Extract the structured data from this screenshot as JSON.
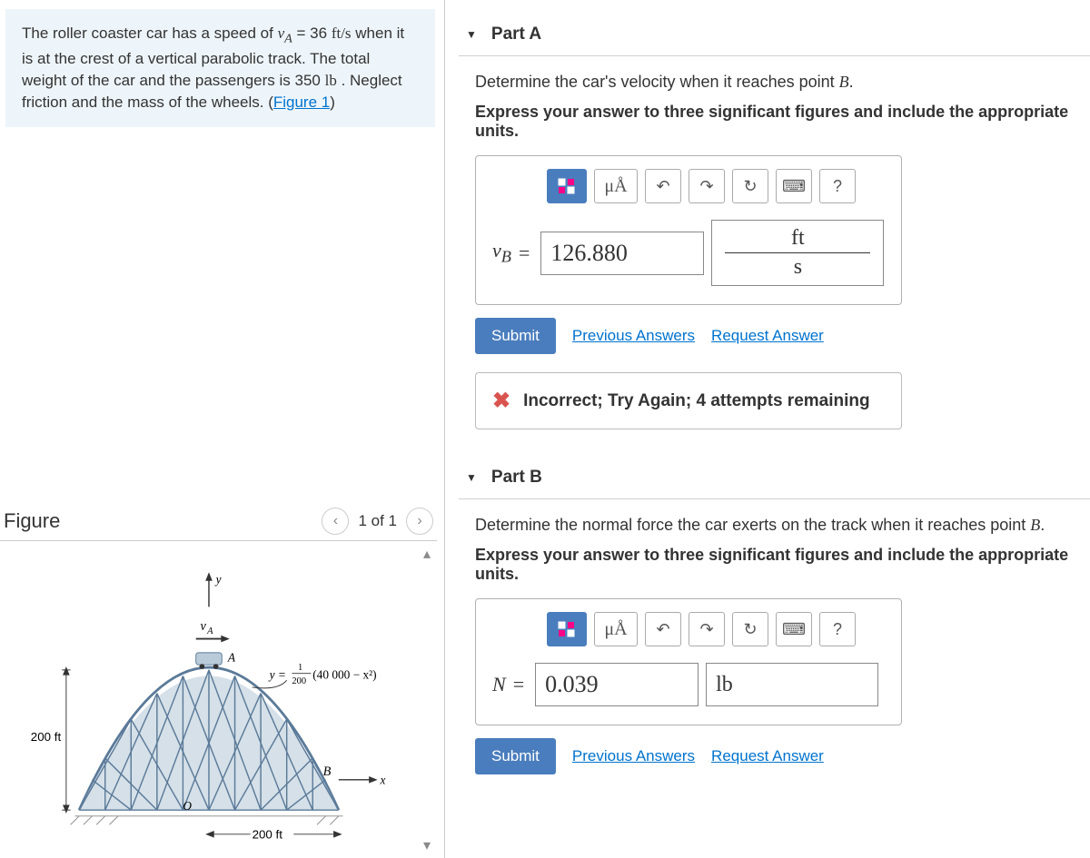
{
  "problem": {
    "text_pre": "The roller coaster car has a speed of ",
    "var_va": "v",
    "sub_a": "A",
    "eq_val": " = 36 ",
    "unit_va": "ft/s",
    "text_mid": " when it is at the crest of a vertical parabolic track. The total weight of the car and the passengers is 350 ",
    "unit_lb": "lb",
    "text_post": " . Neglect friction and the mass of the wheels. (",
    "figure_link": "Figure 1",
    "close": ")"
  },
  "figure": {
    "title": "Figure",
    "pager": "1 of 1",
    "label_va": "vA",
    "label_pointA": "A",
    "label_pointB": "B",
    "label_axis_x": "x",
    "label_axis_y": "y",
    "label_origin": "O",
    "label_height": "200 ft",
    "label_width": "200 ft",
    "eq_y": "y = ",
    "eq_frac_num": "1",
    "eq_frac_den": "200",
    "eq_rest": " (40 000 − x²)"
  },
  "partA": {
    "title": "Part A",
    "prompt_pre": "Determine the car's velocity when it reaches point ",
    "prompt_var": "B",
    "prompt_post": ".",
    "hint": "Express your answer to three significant figures and include the appropriate units.",
    "toolbar_units": "μÅ",
    "var_label": "v",
    "var_sub": "B",
    "value": "126.880",
    "unit_num": "ft",
    "unit_den": "s",
    "submit": "Submit",
    "prev": "Previous Answers",
    "request": "Request Answer",
    "feedback": "Incorrect; Try Again; 4 attempts remaining"
  },
  "partB": {
    "title": "Part B",
    "prompt_pre": "Determine the normal force the car exerts on the track when it reaches point ",
    "prompt_var": "B",
    "prompt_post": ".",
    "hint": "Express your answer to three significant figures and include the appropriate units.",
    "toolbar_units": "μÅ",
    "var_label": "N",
    "value": "0.039",
    "unit": "lb",
    "submit": "Submit",
    "prev": "Previous Answers",
    "request": "Request Answer"
  }
}
